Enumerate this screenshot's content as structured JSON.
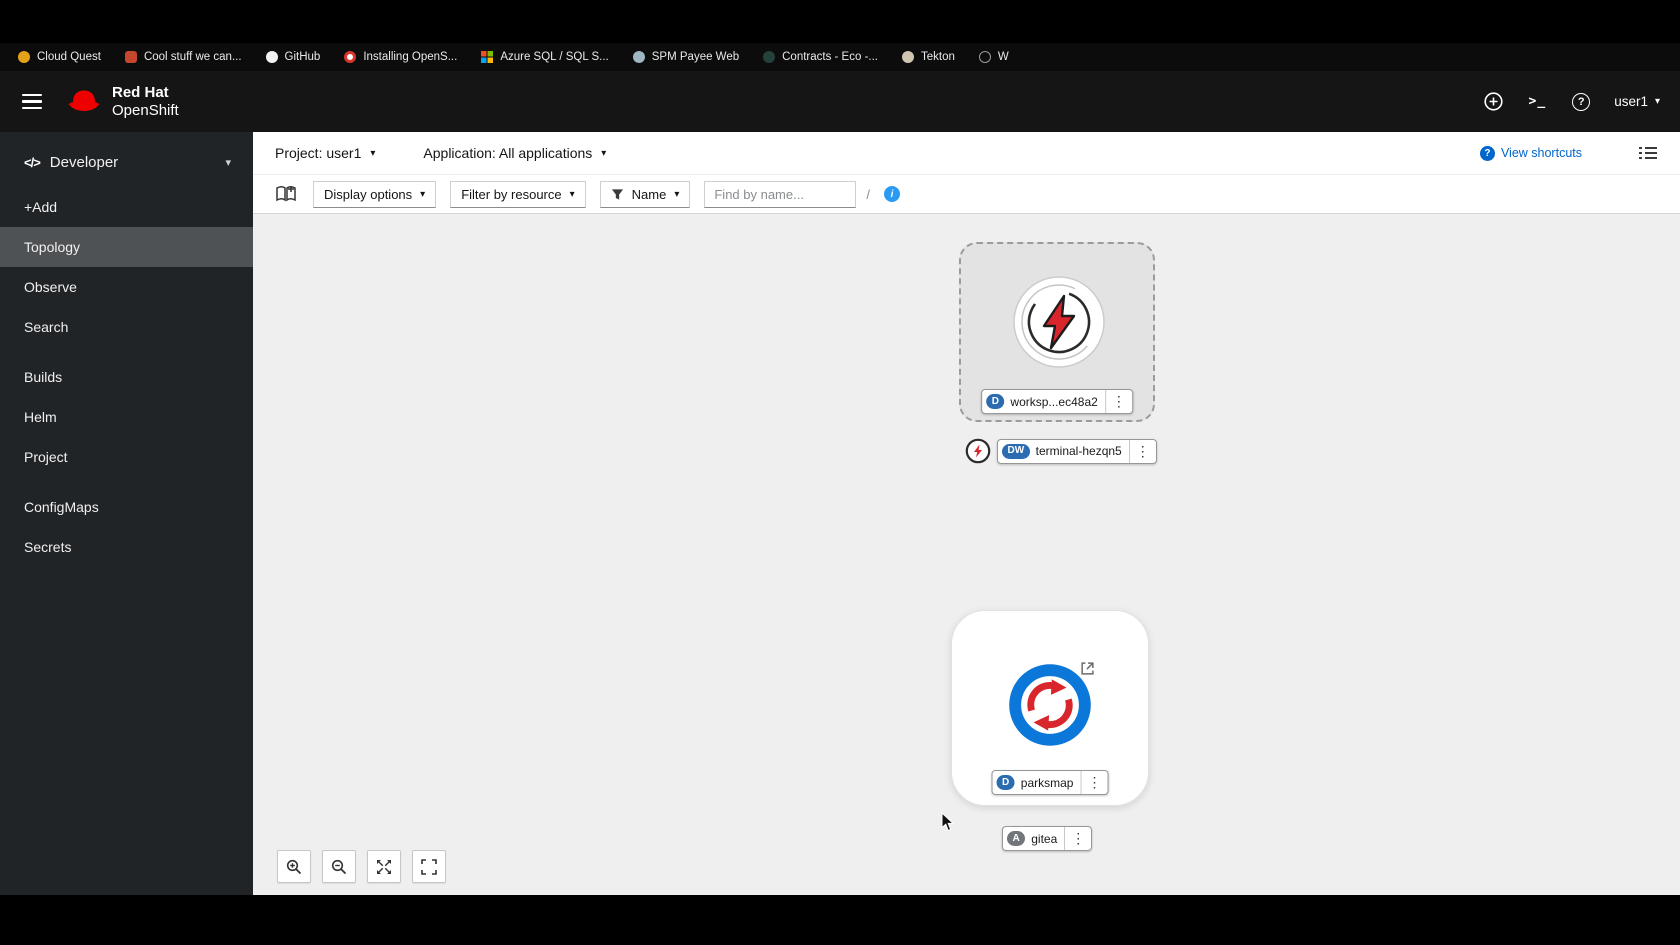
{
  "colors": {
    "brand-red": "#ee0000",
    "link-blue": "#0066cc",
    "info-blue": "#2b9af3",
    "badge-blue": "#2b6cb0",
    "badge-gray": "#72767b",
    "masthead-bg": "#151515",
    "sidebar-bg": "#212427",
    "sidebar-selected-bg": "#4f5255",
    "canvas-bg": "#efefef",
    "parksmap-blue": "#0b77d8",
    "icon-red": "#d9252c"
  },
  "glyphs": {
    "caret_down": "▾",
    "kebab": "⋮",
    "question": "?",
    "info": "i",
    "code": "</>",
    "terminal_prompt": ">_"
  },
  "bookmarks_bar": {
    "items": [
      {
        "label": "Cloud Quest"
      },
      {
        "label": "Cool stuff we can..."
      },
      {
        "label": "GitHub"
      },
      {
        "label": "Installing OpenS..."
      },
      {
        "label": "Azure SQL / SQL S..."
      },
      {
        "label": "SPM Payee Web"
      },
      {
        "label": "Contracts - Eco -..."
      },
      {
        "label": "Tekton"
      },
      {
        "label": "W"
      }
    ]
  },
  "masthead": {
    "brand_line1": "Red Hat",
    "brand_line2": "OpenShift",
    "username": "user1"
  },
  "sidebar": {
    "perspective": "Developer",
    "selected": "Topology",
    "items": [
      {
        "label": "+Add"
      },
      {
        "label": "Topology"
      },
      {
        "label": "Observe"
      },
      {
        "label": "Search"
      },
      {
        "label": "Builds"
      },
      {
        "label": "Helm"
      },
      {
        "label": "Project"
      },
      {
        "label": "ConfigMaps"
      },
      {
        "label": "Secrets"
      }
    ]
  },
  "context_bar": {
    "project": "Project: user1",
    "application": "Application: All applications",
    "view_shortcuts": "View shortcuts"
  },
  "toolbar": {
    "display_options": "Display options",
    "filter_by_resource": "Filter by resource",
    "name_filter": "Name",
    "find_placeholder": "Find by name...",
    "shortcut_hint": "/"
  },
  "topology": {
    "workspace": {
      "badge": "D",
      "label": "worksp...ec48a2"
    },
    "terminal": {
      "badge": "DW",
      "label": "terminal-hezqn5"
    },
    "parksmap": {
      "badge": "D",
      "label": "parksmap"
    },
    "gitea": {
      "badge": "A",
      "label": "gitea"
    }
  }
}
